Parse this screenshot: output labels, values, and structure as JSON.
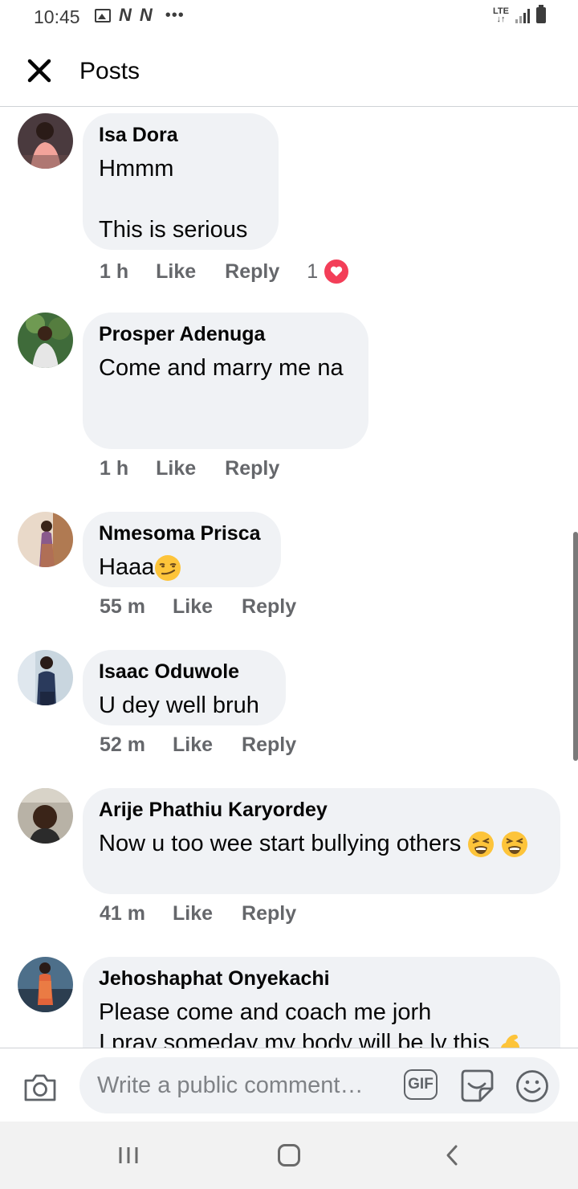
{
  "status_bar": {
    "time": "10:45",
    "notification_icons": [
      "image-icon",
      "n-app-icon",
      "n-app-icon"
    ],
    "n_glyph": "N",
    "more": "•••",
    "network": "LTE"
  },
  "header": {
    "close_icon": "close-icon",
    "title": "Posts"
  },
  "comments": [
    {
      "author": "Isa Dora",
      "text": "Hmmm\n\nThis is serious",
      "time": "1 h",
      "like": "Like",
      "reply": "Reply",
      "reaction_count": "1",
      "reaction": "heart-icon"
    },
    {
      "author": "Prosper Adenuga",
      "text": "Come and marry me na\n\n",
      "time": "1 h",
      "like": "Like",
      "reply": "Reply"
    },
    {
      "author": "Nmesoma Prisca",
      "text": "Haaa",
      "emoji": "smirk-emoji",
      "time": "55 m",
      "like": "Like",
      "reply": "Reply"
    },
    {
      "author": "Isaac Oduwole",
      "text": "U dey well bruh",
      "time": "52 m",
      "like": "Like",
      "reply": "Reply"
    },
    {
      "author": "Arije Phathiu Karyordey",
      "text": "Now u too wee start bullying others ",
      "emoji": "tired-face-emoji",
      "time": "41 m",
      "like": "Like",
      "reply": "Reply"
    },
    {
      "author": "Jehoshaphat Onyekachi",
      "text": "Please come and coach me jorh\nI pray someday my body will be ly this ",
      "emoji": "flexed-biceps-emoji"
    }
  ],
  "composer": {
    "placeholder": "Write a public comment…",
    "gif_label": "GIF",
    "icons": [
      "camera-icon",
      "gif-icon",
      "sticker-icon",
      "smiley-icon"
    ]
  },
  "navbar": {
    "icons": [
      "recent-apps-icon",
      "home-icon",
      "back-icon"
    ]
  },
  "colors": {
    "bubble": "#f0f2f5",
    "secondary_text": "#65676b",
    "heart": "#f33e58",
    "navbar": "#f2f2f2"
  }
}
